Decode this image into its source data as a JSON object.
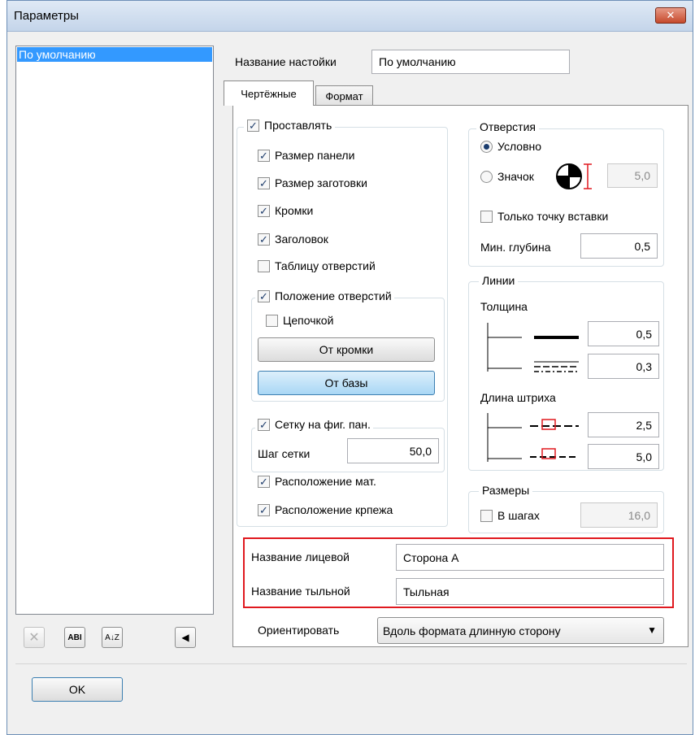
{
  "window": {
    "title": "Параметры",
    "close_glyph": "✕"
  },
  "presets": {
    "items": [
      "По умолчанию"
    ]
  },
  "list_toolbar": {
    "rename": "ABI",
    "sort": "A↓Z",
    "back": "◀",
    "delete": "✕"
  },
  "settings_name": {
    "label": "Название настойки",
    "value": "По умолчанию"
  },
  "tabs": [
    {
      "label": "Чертёжные",
      "active": true
    },
    {
      "label": "Формат",
      "active": false
    }
  ],
  "place": {
    "label": "Проставлять",
    "items": [
      {
        "label": "Размер панели",
        "checked": true
      },
      {
        "label": "Размер заготовки",
        "checked": true
      },
      {
        "label": "Кромки",
        "checked": true
      },
      {
        "label": "Заголовок",
        "checked": true
      },
      {
        "label": "Таблицу отверстий",
        "checked": false
      }
    ],
    "hole_position": {
      "label": "Положение отверстий",
      "checked": true,
      "chain": {
        "label": "Цепочкой",
        "checked": false
      },
      "from_edge": "От кромки",
      "from_base": "От базы"
    },
    "grid": {
      "label": "Сетку на фиг. пан.",
      "checked": true,
      "step_label": "Шаг сетки",
      "step_value": "50,0"
    },
    "material_layout": {
      "label": "Расположение мат.",
      "checked": true
    },
    "fastener_layout": {
      "label": "Расположение крпежа",
      "checked": true
    }
  },
  "holes": {
    "title": "Отверстия",
    "conditional": "Условно",
    "icon": "Значок",
    "icon_size": "5,0",
    "insert_point_only": "Только точку вставки",
    "min_depth_label": "Мин. глубина",
    "min_depth_value": "0,5"
  },
  "lines": {
    "title": "Линии",
    "thickness_label": "Толщина",
    "thick_value": "0,5",
    "thin_value": "0,3",
    "dash_label": "Длина штриха",
    "dash_value_1": "2,5",
    "dash_value_2": "5,0"
  },
  "dimensions": {
    "title": "Размеры",
    "in_steps": "В шагах",
    "value": "16,0"
  },
  "side_names": {
    "front_label": "Название лицевой",
    "front_value": "Сторона А",
    "back_label": "Название тыльной",
    "back_value": "Тыльная"
  },
  "orient": {
    "label": "Ориентировать",
    "value": "Вдоль формата длинную сторону"
  },
  "footer": {
    "ok": "OK"
  },
  "colors": {
    "accent": "#3399ff",
    "highlight": "#e0191f"
  }
}
